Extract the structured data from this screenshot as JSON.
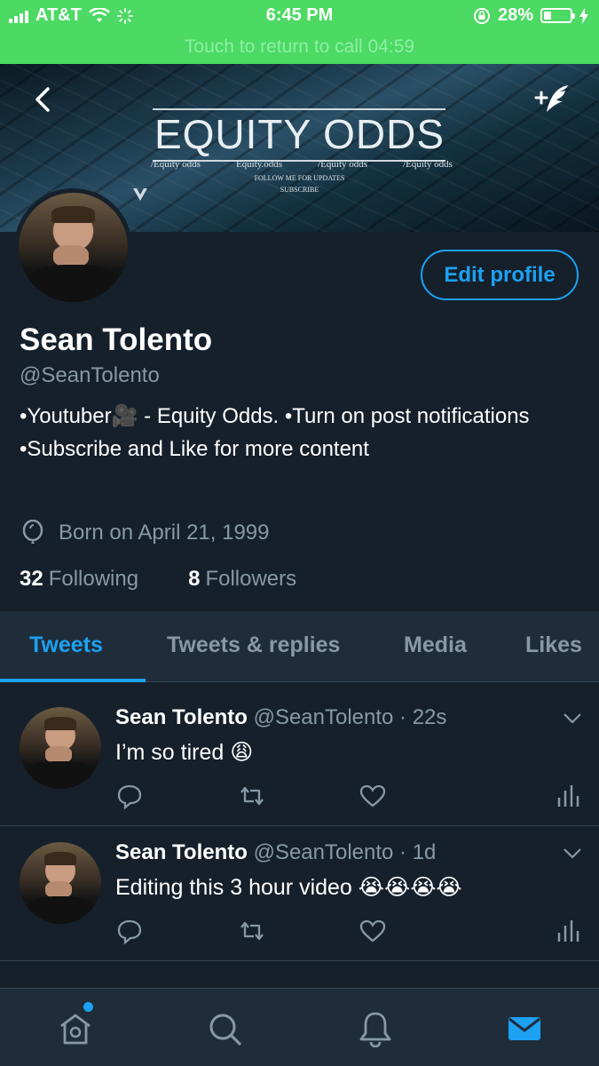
{
  "status_bar": {
    "carrier": "AT&T",
    "time": "6:45 PM",
    "battery": "28%"
  },
  "call_bar": {
    "text": "Touch to return to call 04:59"
  },
  "banner": {
    "title": "EQUITY ODDS",
    "handles": [
      "/Equity odds",
      "Equity.odds",
      "/Equity odds",
      "/Equity odds"
    ],
    "line1": "FOLLOW ME FOR UPDATES",
    "line2": "SUBSCRIBE"
  },
  "profile": {
    "name": "Sean Tolento",
    "handle": "@SeanTolento",
    "bio": "•Youtuber🎥 - Equity Odds. •Turn on post notifications •Subscribe and Like for more content",
    "born": "Born on April 21, 1999",
    "following_count": "32",
    "following_label": "Following",
    "followers_count": "8",
    "followers_label": "Followers",
    "edit_label": "Edit profile"
  },
  "tabs": [
    "Tweets",
    "Tweets & replies",
    "Media",
    "Likes"
  ],
  "tweets": [
    {
      "name": "Sean Tolento",
      "meta": "@SeanTolento · 22s",
      "text": "I’m so tired 😩"
    },
    {
      "name": "Sean Tolento",
      "meta": "@SeanTolento · 1d",
      "text": "Editing this 3 hour video 😭😭😭😭"
    }
  ],
  "colors": {
    "background": "#15202b",
    "accent": "#1da1f2",
    "secondary_text": "#8899a6",
    "call_bar": "#4cd964"
  },
  "icons": {
    "back": "chevron-left-icon",
    "compose": "compose-feather-icon",
    "location": "balloon-icon",
    "reply": "reply-icon",
    "retweet": "retweet-icon",
    "like": "heart-icon",
    "analytics": "analytics-icon",
    "home": "home-icon",
    "search": "search-icon",
    "notifications": "bell-icon",
    "messages": "mail-icon"
  }
}
